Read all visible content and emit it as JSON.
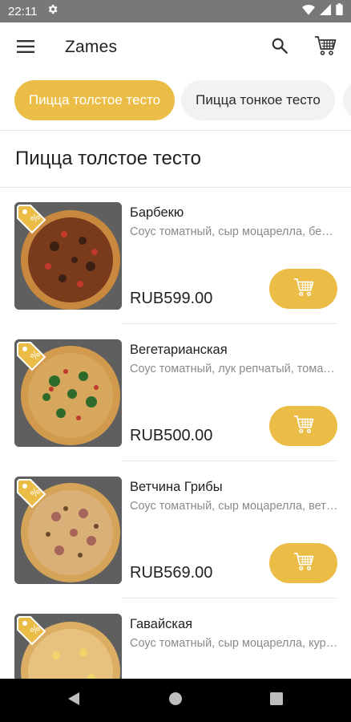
{
  "status_bar": {
    "time": "22:11",
    "icons": [
      "settings-icon",
      "wifi-icon",
      "signal-icon",
      "battery-icon"
    ]
  },
  "app_bar": {
    "title": "Zames",
    "icons": [
      "menu-icon",
      "search-icon",
      "cart-icon"
    ]
  },
  "tabs": [
    {
      "label": "Пицца толстое тесто",
      "active": true
    },
    {
      "label": "Пицца тонкое тесто",
      "active": false
    }
  ],
  "section_title": "Пицца толстое тесто",
  "products": [
    {
      "name": "Барбекю",
      "description": "Соус томатный, сыр моцарелла, бекон, колбаски, лук, соус барбекю",
      "price": "RUB599.00",
      "topping": "bbq"
    },
    {
      "name": "Вегетарианская",
      "description": "Соус томатный, лук репчатый, томаты, перец, грибы, зелень",
      "price": "RUB500.00",
      "topping": "veg"
    },
    {
      "name": "Ветчина Грибы",
      "description": "Соус томатный, сыр моцарелла, ветчина, грибы",
      "price": "RUB569.00",
      "topping": "ham"
    },
    {
      "name": "Гавайская",
      "description": "Соус томатный, сыр моцарелла, курица, ананас",
      "price": "",
      "topping": "hawaii"
    }
  ],
  "colors": {
    "accent": "#ebbd47",
    "status_bar": "#787878",
    "nav_bar": "#000000",
    "chip_inactive": "#f2f2f2"
  }
}
